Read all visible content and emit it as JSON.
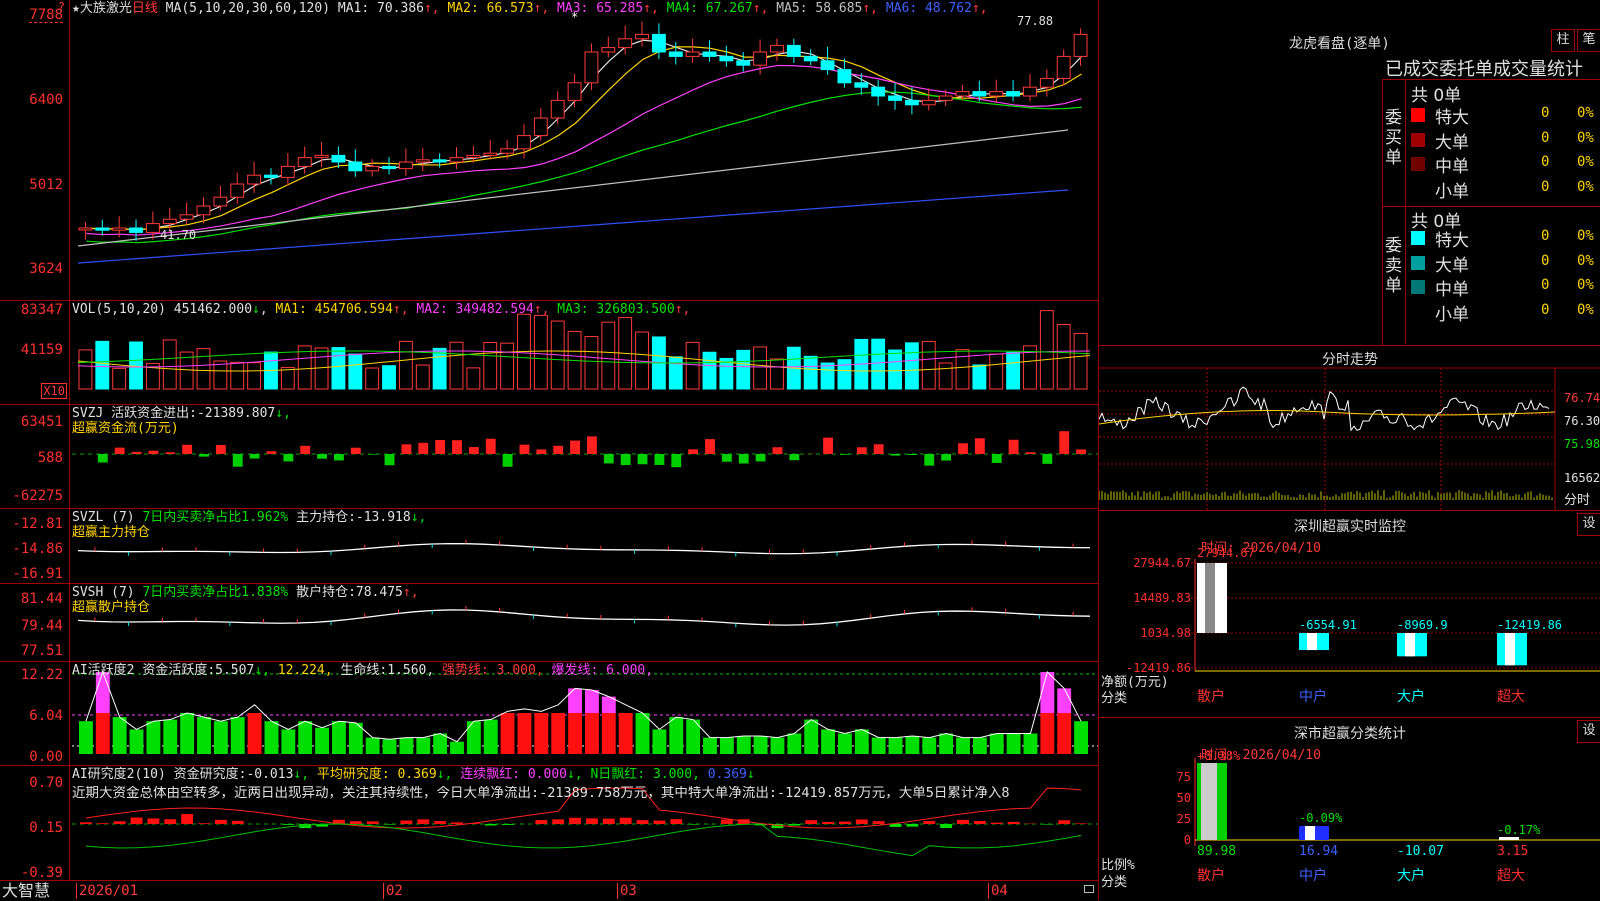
{
  "stock": {
    "name": "★大族激光",
    "period": "日线"
  },
  "kline": {
    "ma_header": "MA(5,10,20,30,60,120)",
    "ma": [
      {
        "label": "MA1:",
        "value": "70.386",
        "arrow": "↑",
        "color": "#e0e0e0"
      },
      {
        "label": "MA2:",
        "value": "66.573",
        "arrow": "↑",
        "color": "#ffd400"
      },
      {
        "label": "MA3:",
        "value": "65.285",
        "arrow": "↑",
        "color": "#ff40ff"
      },
      {
        "label": "MA4:",
        "value": "67.267",
        "arrow": "↑",
        "color": "#00e000"
      },
      {
        "label": "MA5:",
        "value": "58.685",
        "arrow": "↑",
        "color": "#c0c0c0"
      },
      {
        "label": "MA6:",
        "value": "48.762",
        "arrow": "↑",
        "color": "#4060ff"
      }
    ],
    "yticks": [
      "7788",
      "6400",
      "5012",
      "3624"
    ],
    "high_label": "77.88",
    "low_label": "41.70",
    "question": "?"
  },
  "vol": {
    "header": "VOL(5,10,20)",
    "value": "451462.000",
    "value_arrow": "↓",
    "ma": [
      {
        "label": "MA1:",
        "value": "454706.594",
        "arrow": "↑",
        "color": "#ffd400"
      },
      {
        "label": "MA2:",
        "value": "349482.594",
        "arrow": "↑",
        "color": "#ff40ff"
      },
      {
        "label": "MA3:",
        "value": "326803.500",
        "arrow": "↑",
        "color": "#00e000"
      }
    ],
    "yticks": [
      "83347",
      "41159"
    ],
    "unit": "X10"
  },
  "svzj": {
    "name": "SVZJ",
    "label": "活跃资金进出:",
    "value": "-21389.807",
    "arrow": "↓,",
    "sub": "超赢资金流(万元)",
    "yticks": [
      "63451",
      "588",
      "-62275"
    ]
  },
  "svzl": {
    "name": "SVZL (7)",
    "pct_label": "7日内买卖净占比1.962%",
    "hold_label": "主力持仓:",
    "hold_value": "-13.918",
    "arrow": "↓,",
    "sub": "超赢主力持仓",
    "yticks": [
      "-12.81",
      "-14.86",
      "-16.91"
    ]
  },
  "svsh": {
    "name": "SVSH (7)",
    "pct_label": "7日内买卖净占比1.838%",
    "hold_label": "散户持仓:",
    "hold_value": "78.475",
    "arrow": "↑,",
    "sub": "超赢散户持仓",
    "yticks": [
      "81.44",
      "79.44",
      "77.51"
    ]
  },
  "ai_act": {
    "name": "AI活跃度2",
    "label": "资金活跃度:",
    "value": "5.507",
    "arrow": "↓,",
    "v2": "12.224,",
    "life_label": "生命线:",
    "life_value": "1.560,",
    "strong": "强势线: 3.000,",
    "burst": "爆发线: 6.000,",
    "yticks": [
      "12.22",
      "6.04",
      "0.00"
    ]
  },
  "ai_res": {
    "name": "AI研究度2(10)",
    "label": "资金研究度:",
    "value": "-0.013",
    "arrow": "↓,",
    "avg": "平均研究度: 0.369",
    "avg_arrow": "↓,",
    "red_label": "连续飘红: 0.000",
    "red_arrow": "↓,",
    "n_label": "N日飘红: 3.000,",
    "n_value": "0.369",
    "n_arrow": "↓",
    "comment": "近期大资金总体由空转多，近两日出现异动，关注其持续性，今日大单净流出:-21389.758万元，其中特大单净流出:-12419.857万元，大单5日累计净入8",
    "yticks": [
      "0.70",
      "0.15",
      "-0.39"
    ]
  },
  "xaxis": {
    "labels": [
      "2026/01",
      "02",
      "03",
      "04"
    ]
  },
  "brand": "大智慧",
  "right": {
    "lhb_title": "龙虎看盘(逐单)",
    "btn_bar": "柱",
    "btn_pen": "笔",
    "sub_header": "已成交委托单成交量统计",
    "buy": {
      "side": "委买单",
      "total": "共 0单",
      "rows": [
        {
          "label": "特大",
          "count": "0",
          "pct": "0%",
          "color": "#ff0000"
        },
        {
          "label": "大单",
          "count": "0",
          "pct": "0%",
          "color": "#a00000"
        },
        {
          "label": "中单",
          "count": "0",
          "pct": "0%",
          "color": "#700000"
        },
        {
          "label": "小单",
          "count": "0",
          "pct": "0%",
          "color": "#000000"
        }
      ]
    },
    "sell": {
      "side": "委卖单",
      "total": "共 0单",
      "rows": [
        {
          "label": "特大",
          "count": "0",
          "pct": "0%",
          "color": "#00ffff"
        },
        {
          "label": "大单",
          "count": "0",
          "pct": "0%",
          "color": "#00a0a0"
        },
        {
          "label": "中单",
          "count": "0",
          "pct": "0%",
          "color": "#007878"
        },
        {
          "label": "小单",
          "count": "0",
          "pct": "0%",
          "color": "#000000"
        }
      ]
    },
    "intraday": {
      "title": "分时走势",
      "yticks": [
        "76.74",
        "76.30",
        "75.98"
      ],
      "vol_label": "16562",
      "unit": "分时"
    },
    "monitor": {
      "title": "深圳超赢实时监控",
      "btn": "设",
      "date": "时间: 2026/04/10",
      "yticks": [
        "27944.67",
        "14489.83",
        "1034.98",
        "-12419.86"
      ],
      "ylabel": "净额(万元)",
      "xlabel": "分类",
      "values": [
        "27944.67",
        "-6554.91",
        "-8969.9",
        "-12419.86"
      ],
      "categories": [
        "散户",
        "中户",
        "大户",
        "超大"
      ]
    },
    "classify": {
      "title": "深市超赢分类统计",
      "btn": "设",
      "date": "时间: 2026/04/10",
      "yticks": [
        "75",
        "50",
        "25",
        "0"
      ],
      "ylabel": "比例%",
      "xlabel": "分类",
      "top_values": [
        "+0.38%",
        "-0.09%",
        "",
        "-0.17%"
      ],
      "values": [
        "89.98",
        "16.94",
        "-10.07",
        "3.15"
      ],
      "categories": [
        "散户",
        "中户",
        "大户",
        "超大"
      ]
    }
  },
  "colors": {
    "up": "#ff3a3a",
    "down": "#00ffff",
    "grid": "#a00000"
  }
}
